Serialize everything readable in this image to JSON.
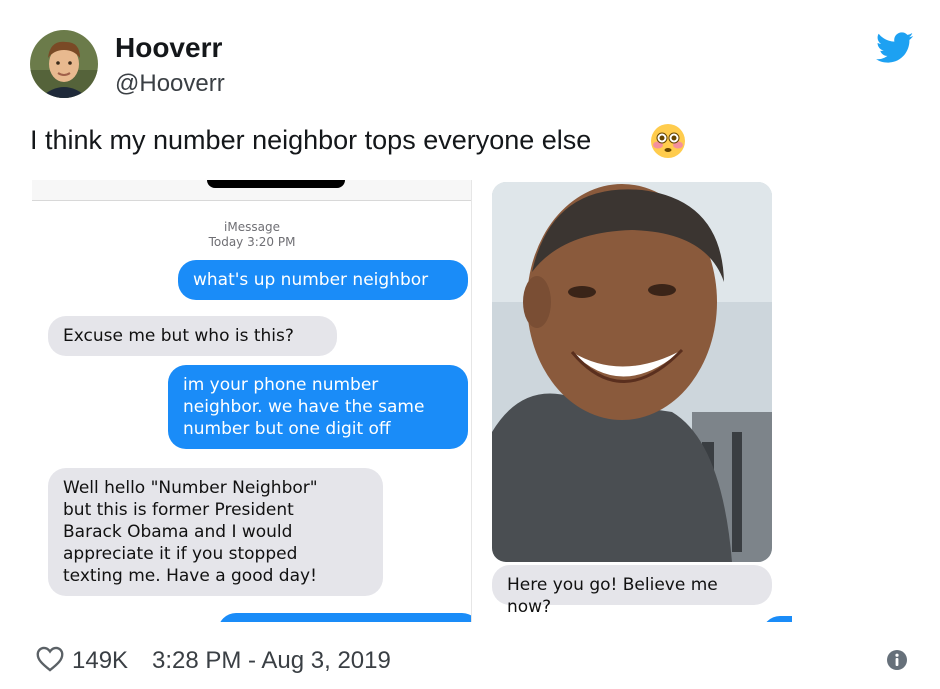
{
  "user": {
    "display_name": "Hooverr",
    "handle": "@Hooverr"
  },
  "tweet": {
    "text": "I think my number neighbor tops everyone else"
  },
  "screenshot_left": {
    "header_line1": "iMessage",
    "header_line2": "Today 3:20 PM",
    "messages": [
      {
        "side": "sent",
        "text": "what's up number neighbor"
      },
      {
        "side": "received",
        "text": "Excuse me but who is this?"
      },
      {
        "side": "sent",
        "lines": [
          "im your phone number",
          "neighbor. we have the same",
          "number but one digit off"
        ]
      },
      {
        "side": "received",
        "lines": [
          "Well hello \"Number Neighbor\"",
          "but this is former President",
          "Barack Obama and I would",
          "appreciate it if you stopped",
          "texting me. Have a good day!"
        ]
      }
    ]
  },
  "screenshot_right": {
    "reply_text": "Here you go! Believe me now?"
  },
  "footer": {
    "likes": "149K",
    "timestamp": "3:28 PM - Aug 3, 2019"
  },
  "colors": {
    "sent_bubble": "#1a8cf8",
    "received_bubble": "#e5e5ea",
    "twitter_blue": "#1da1f2"
  },
  "icons": [
    "bird-icon",
    "flushed-emoji-icon",
    "heart-icon",
    "info-icon"
  ]
}
